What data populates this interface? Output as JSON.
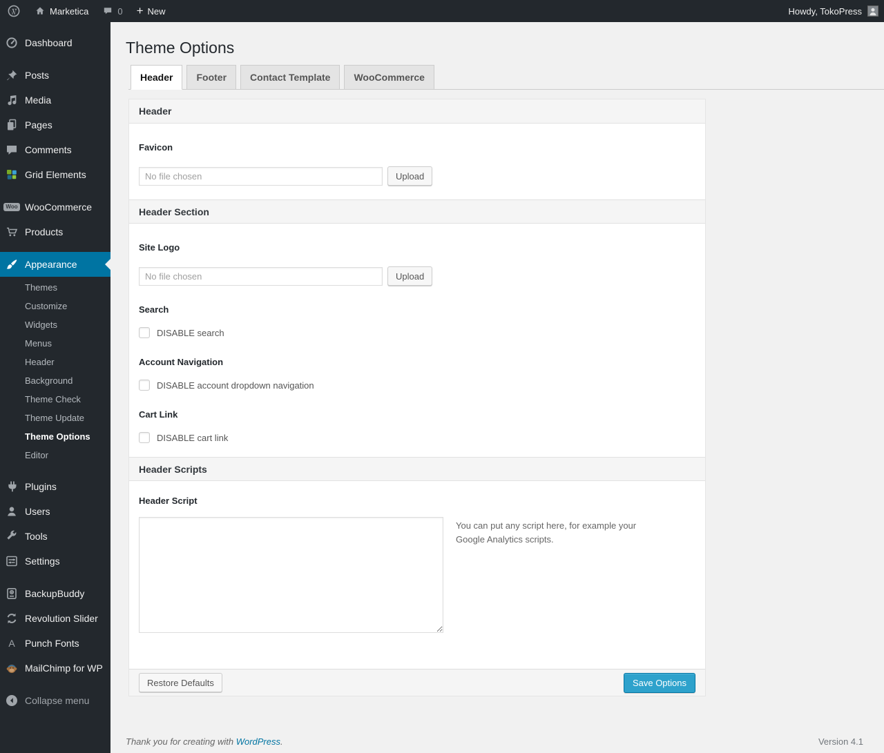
{
  "admin_bar": {
    "site_name": "Marketica",
    "comments_count": "0",
    "new_label": "New",
    "howdy": "Howdy, TokoPress"
  },
  "sidebar": {
    "items": [
      {
        "label": "Dashboard",
        "icon": "dashboard-icon"
      },
      {
        "label": "Posts",
        "icon": "pushpin-icon"
      },
      {
        "label": "Media",
        "icon": "media-note-icon"
      },
      {
        "label": "Pages",
        "icon": "pages-icon"
      },
      {
        "label": "Comments",
        "icon": "comment-bubble-icon"
      },
      {
        "label": "Grid Elements",
        "icon": "grid-elements-icon"
      },
      {
        "label": "WooCommerce",
        "icon": "woo-badge-icon"
      },
      {
        "label": "Products",
        "icon": "cart-icon"
      },
      {
        "label": "Appearance",
        "icon": "brush-icon",
        "active": true
      },
      {
        "label": "Plugins",
        "icon": "plug-icon"
      },
      {
        "label": "Users",
        "icon": "user-icon"
      },
      {
        "label": "Tools",
        "icon": "wrench-icon"
      },
      {
        "label": "Settings",
        "icon": "settings-sliders-icon"
      },
      {
        "label": "BackupBuddy",
        "icon": "backup-drive-icon"
      },
      {
        "label": "Revolution Slider",
        "icon": "circular-arrows-icon"
      },
      {
        "label": "Punch Fonts",
        "icon": "letter-a-icon"
      },
      {
        "label": "MailChimp for WP",
        "icon": "monkey-icon"
      },
      {
        "label": "Collapse menu",
        "icon": "collapse-arrow-icon"
      }
    ],
    "appearance_submenu": [
      "Themes",
      "Customize",
      "Widgets",
      "Menus",
      "Header",
      "Background",
      "Theme Check",
      "Theme Update",
      "Theme Options",
      "Editor"
    ],
    "active_item": "Appearance",
    "current_submenu_item": "Theme Options"
  },
  "main": {
    "title": "Theme Options",
    "tabs": [
      {
        "label": "Header",
        "active": true
      },
      {
        "label": "Footer",
        "active": false
      },
      {
        "label": "Contact Template",
        "active": false
      },
      {
        "label": "WooCommerce",
        "active": false
      }
    ]
  },
  "panel": {
    "section1_title": "Header",
    "favicon_label": "Favicon",
    "favicon_placeholder": "No file chosen",
    "favicon_upload": "Upload",
    "section2_title": "Header Section",
    "site_logo_label": "Site Logo",
    "site_logo_placeholder": "No file chosen",
    "site_logo_upload": "Upload",
    "search_label": "Search",
    "search_checkbox_label": "DISABLE search",
    "search_checked": false,
    "account_nav_label": "Account Navigation",
    "account_nav_checkbox_label": "DISABLE account dropdown navigation",
    "account_nav_checked": false,
    "cart_link_label": "Cart Link",
    "cart_link_checkbox_label": "DISABLE cart link",
    "cart_link_checked": false,
    "section3_title": "Header Scripts",
    "header_script_label": "Header Script",
    "header_script_value": "",
    "header_script_help": "You can put any script here, for example your Google Analytics scripts.",
    "restore_button": "Restore Defaults",
    "save_button": "Save Options"
  },
  "footer": {
    "thanks_text": "Thank you for creating with",
    "link_label": "WordPress",
    "suffix": ".",
    "version": "Version 4.1"
  },
  "colors": {
    "accent_blue": "#0074a2",
    "primary_button_blue": "#2ea2cc",
    "admin_dark": "#23282d",
    "page_background": "#f1f1f1"
  }
}
